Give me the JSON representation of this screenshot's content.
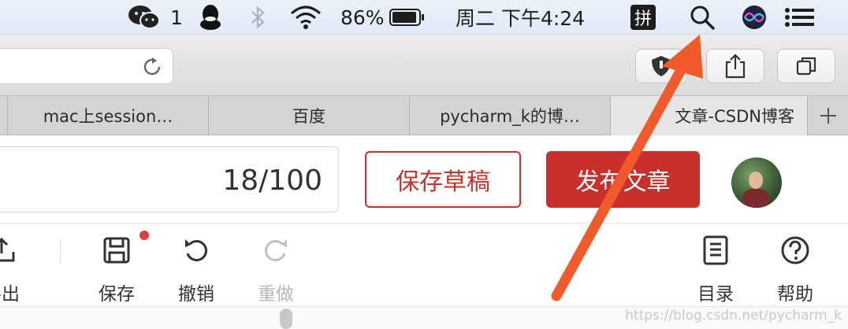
{
  "menubar": {
    "wechat_count": "1",
    "battery": "86%",
    "clock": "周二 下午4:24",
    "input_method": "拼",
    "icons": [
      "wechat-icon",
      "qq-icon",
      "bluetooth-icon",
      "wifi-icon",
      "battery-icon",
      "input-method-icon",
      "spotlight-search-icon",
      "siri-icon",
      "list-menu-icon"
    ]
  },
  "tabs": [
    {
      "label": "mac上session…"
    },
    {
      "label": "百度"
    },
    {
      "label": "pycharm_k的博…"
    },
    {
      "label": "文章-CSDN博客"
    }
  ],
  "editor": {
    "title_counter": "18/100",
    "save_draft_label": "保存草稿",
    "publish_label": "发布文章"
  },
  "tools": {
    "export": "导出",
    "save": "保存",
    "undo": "撤销",
    "redo": "重做",
    "toc": "目录",
    "help": "帮助"
  },
  "watermark": "https://blog.csdn.net/pycharm_k",
  "colors": {
    "accent": "#c9302c",
    "annotation_arrow": "#f15a2b"
  }
}
